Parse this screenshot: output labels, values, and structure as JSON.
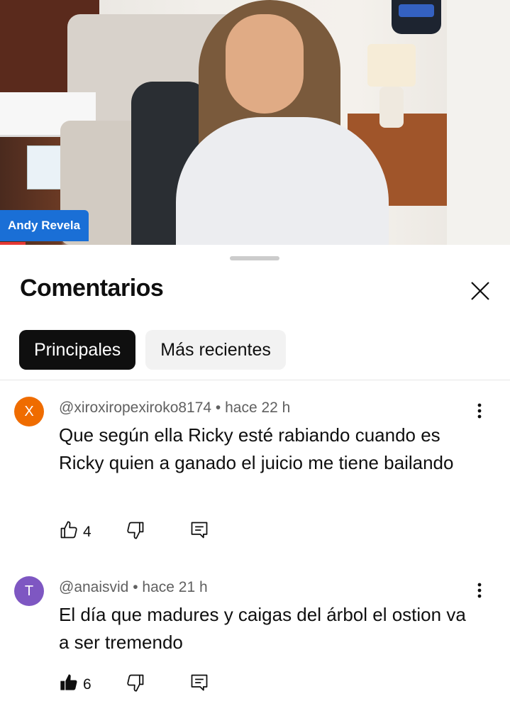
{
  "video": {
    "channel_badge": "Andy Revela"
  },
  "sheet": {
    "title": "Comentarios",
    "close_icon": "close-icon",
    "chips": [
      {
        "label": "Principales",
        "selected": true
      },
      {
        "label": "Más recientes",
        "selected": false
      }
    ]
  },
  "comments": [
    {
      "avatar_letter": "X",
      "avatar_color": "#ef6c00",
      "author": "@xiroxiropexiroko8174",
      "time": "hace 22 h",
      "meta": "@xiroxiropexiroko8174 • hace 22 h",
      "text": "Que según ella Ricky esté rabiando cuando es Ricky quien a ganado el juicio me tiene bailando",
      "likes": "4",
      "liked": false
    },
    {
      "avatar_letter": "T",
      "avatar_color": "#7e57c2",
      "author": "@anaisvid",
      "time": "hace 21 h",
      "meta": "@anaisvid • hace 21 h",
      "text": "El día que madures y caigas del árbol el ostion va a ser tremendo",
      "likes": "6",
      "liked": true
    }
  ],
  "colors": {
    "accent_badge": "#1a6fd6",
    "chip_active": "#0f0f0f",
    "chip_inactive": "#f2f2f2"
  }
}
